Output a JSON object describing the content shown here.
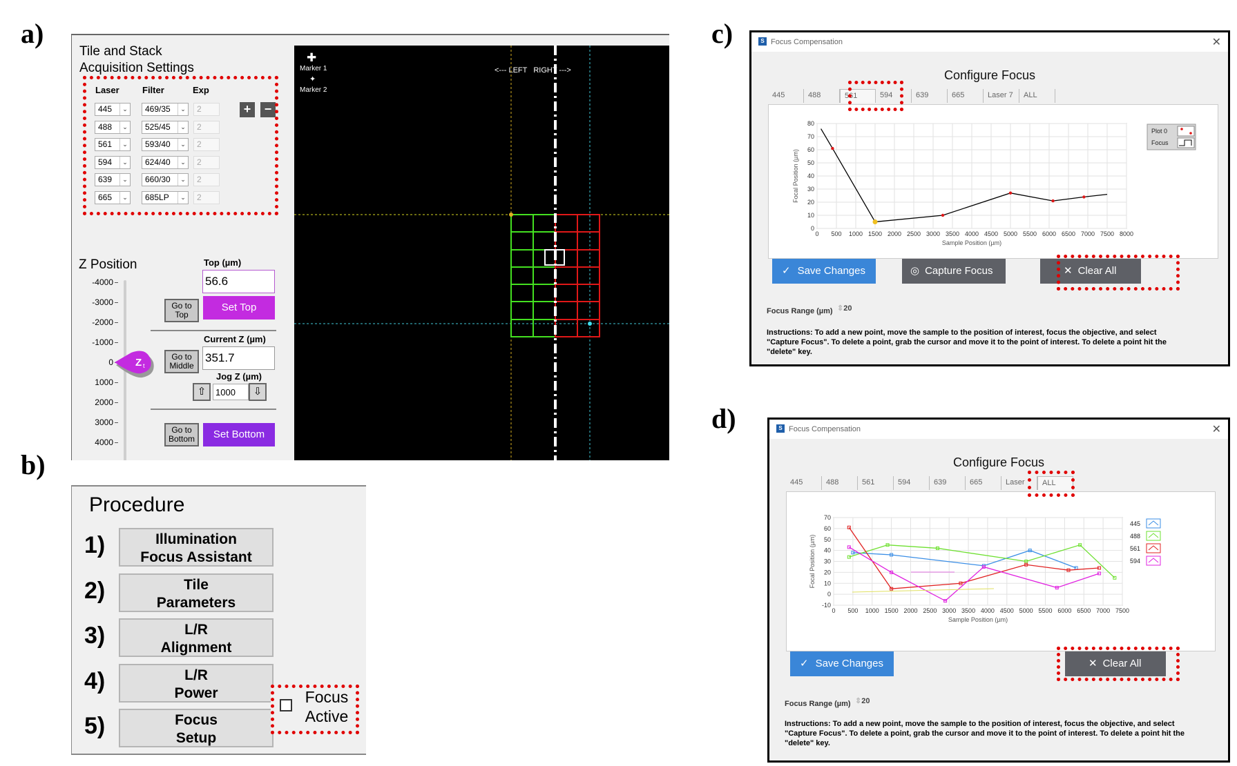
{
  "labels": {
    "a": "a)",
    "b": "b)",
    "c": "c)",
    "d": "d)"
  },
  "panelA": {
    "title_line1": "Tile and Stack",
    "title_line2": "Acquisition Settings",
    "col_laser": "Laser",
    "col_filter": "Filter",
    "col_exp": "Exp",
    "rows": [
      {
        "laser": "445",
        "filter": "469/35",
        "exp": "2"
      },
      {
        "laser": "488",
        "filter": "525/45",
        "exp": "2"
      },
      {
        "laser": "561",
        "filter": "593/40",
        "exp": "2"
      },
      {
        "laser": "594",
        "filter": "624/40",
        "exp": "2"
      },
      {
        "laser": "639",
        "filter": "660/30",
        "exp": "2"
      },
      {
        "laser": "665",
        "filter": "685LP",
        "exp": "2"
      }
    ],
    "plus": "+",
    "minus": "−",
    "zpos_title": "Z Position",
    "z_ticks": [
      "-4000",
      "-3000",
      "-2000",
      "-1000",
      "0",
      "1000",
      "2000",
      "3000",
      "4000"
    ],
    "zt_label": "Zt",
    "top_label": "Top (µm)",
    "top_value": "56.6",
    "goto_top": "Go to Top",
    "set_top": "Set Top",
    "current_label": "Current Z (µm)",
    "current_value": "351.7",
    "goto_middle": "Go to Middle",
    "jog_label": "Jog Z (µm)",
    "jog_value": "1000",
    "goto_bottom": "Go to Bottom",
    "set_bottom": "Set Bottom",
    "marker1": "Marker 1",
    "marker2": "Marker 2",
    "left_right": "<--- LEFT   RIGHT --->",
    "colors": {
      "purple": "#c32be0",
      "green": "#44e020",
      "red": "#e01818"
    }
  },
  "panelB": {
    "title": "Procedure",
    "steps": [
      {
        "num": "1)",
        "line1": "Illumination",
        "line2": "Focus Assistant"
      },
      {
        "num": "2)",
        "line1": "Tile",
        "line2": "Parameters"
      },
      {
        "num": "3)",
        "line1": "L/R",
        "line2": "Alignment"
      },
      {
        "num": "4)",
        "line1": "L/R",
        "line2": "Power"
      },
      {
        "num": "5)",
        "line1": "Focus",
        "line2": "Setup"
      }
    ],
    "focus_active1": "Focus",
    "focus_active2": "Active"
  },
  "panelC": {
    "window_title": "Focus Compensation",
    "heading": "Configure Focus",
    "tabs": [
      "445",
      "488",
      "561",
      "594",
      "639",
      "665",
      "Laser 7",
      "ALL"
    ],
    "selected_tab": "561",
    "ylabel": "Focal Position (µm)",
    "xlabel": "Sample Position (µm)",
    "legend": [
      "Plot 0",
      "Focus"
    ],
    "save": "Save Changes",
    "capture": "Capture Focus",
    "clear": "Clear All",
    "focus_range_label": "Focus Range (µm)",
    "focus_range_value": "20",
    "instructions": "Instructions: To add a new point, move the sample to the position of interest, focus the objective, and select \"Capture Focus\". To delete a point, grab the cursor and move it to the point of interest. To delete a point hit the \"delete\" key."
  },
  "panelD": {
    "window_title": "Focus Compensation",
    "heading": "Configure Focus",
    "tabs": [
      "445",
      "488",
      "561",
      "594",
      "639",
      "665",
      "Laser",
      "ALL"
    ],
    "selected_tab": "ALL",
    "ylabel": "Focal Position (µm)",
    "xlabel": "Sample Position (µm)",
    "legend": [
      "445",
      "488",
      "561",
      "594"
    ],
    "save": "Save Changes",
    "clear": "Clear All",
    "focus_range_label": "Focus Range (µm)",
    "focus_range_value": "20",
    "instructions": "Instructions: To add a new point, move the sample to the position of interest, focus the objective, and select \"Capture Focus\". To delete a point, grab the cursor and move it to the point of interest. To delete a point hit the \"delete\" key."
  },
  "chart_data": [
    {
      "type": "line",
      "title": "",
      "xlabel": "Sample Position (µm)",
      "ylabel": "Focal Position (µm)",
      "xlim": [
        0,
        8000
      ],
      "ylim": [
        0,
        80
      ],
      "xticks": [
        0,
        500,
        1000,
        1500,
        2000,
        2500,
        3000,
        3500,
        4000,
        4500,
        5000,
        5500,
        6000,
        6500,
        7000,
        7500,
        8000
      ],
      "yticks": [
        0,
        10,
        20,
        30,
        40,
        50,
        60,
        70,
        80
      ],
      "series": [
        {
          "name": "Focus",
          "color": "#000000",
          "x": [
            100,
            400,
            1500,
            3250,
            5000,
            6100,
            6900,
            7500
          ],
          "y": [
            76,
            61,
            5,
            10,
            27,
            21,
            24,
            26
          ]
        }
      ],
      "markers": {
        "x": [
          400,
          1500,
          3250,
          5000,
          6100,
          6900
        ],
        "y": [
          61,
          5,
          10,
          27,
          21,
          24
        ]
      },
      "cursor": {
        "x": 1500,
        "y": 5
      },
      "grid": true,
      "legend_position": "top-right"
    },
    {
      "type": "line",
      "title": "",
      "xlabel": "Sample Position (µm)",
      "ylabel": "Focal Position (µm)",
      "xlim": [
        0,
        7500
      ],
      "ylim": [
        -10,
        70
      ],
      "xticks": [
        0,
        500,
        1000,
        1500,
        2000,
        2500,
        3000,
        3500,
        4000,
        4500,
        5000,
        5500,
        6000,
        6500,
        7000,
        7500
      ],
      "yticks": [
        -10,
        0,
        10,
        20,
        30,
        40,
        50,
        60,
        70
      ],
      "series": [
        {
          "name": "445",
          "color": "#3a8ee6",
          "x": [
            500,
            1500,
            3900,
            5100,
            6300
          ],
          "y": [
            38,
            36,
            26,
            40,
            24
          ]
        },
        {
          "name": "488",
          "color": "#6ee030",
          "x": [
            400,
            1400,
            2700,
            5000,
            6400,
            7300
          ],
          "y": [
            34,
            45,
            42,
            30,
            45,
            15
          ]
        },
        {
          "name": "561",
          "color": "#e02020",
          "x": [
            400,
            1500,
            3300,
            5000,
            6100,
            6900
          ],
          "y": [
            61,
            5,
            10,
            27,
            22,
            24
          ]
        },
        {
          "name": "594",
          "color": "#e020e0",
          "x": [
            400,
            1500,
            2900,
            3900,
            5800,
            6900
          ],
          "y": [
            43,
            20,
            -6,
            25,
            6,
            19
          ]
        }
      ],
      "grid": true,
      "legend_position": "right"
    }
  ]
}
